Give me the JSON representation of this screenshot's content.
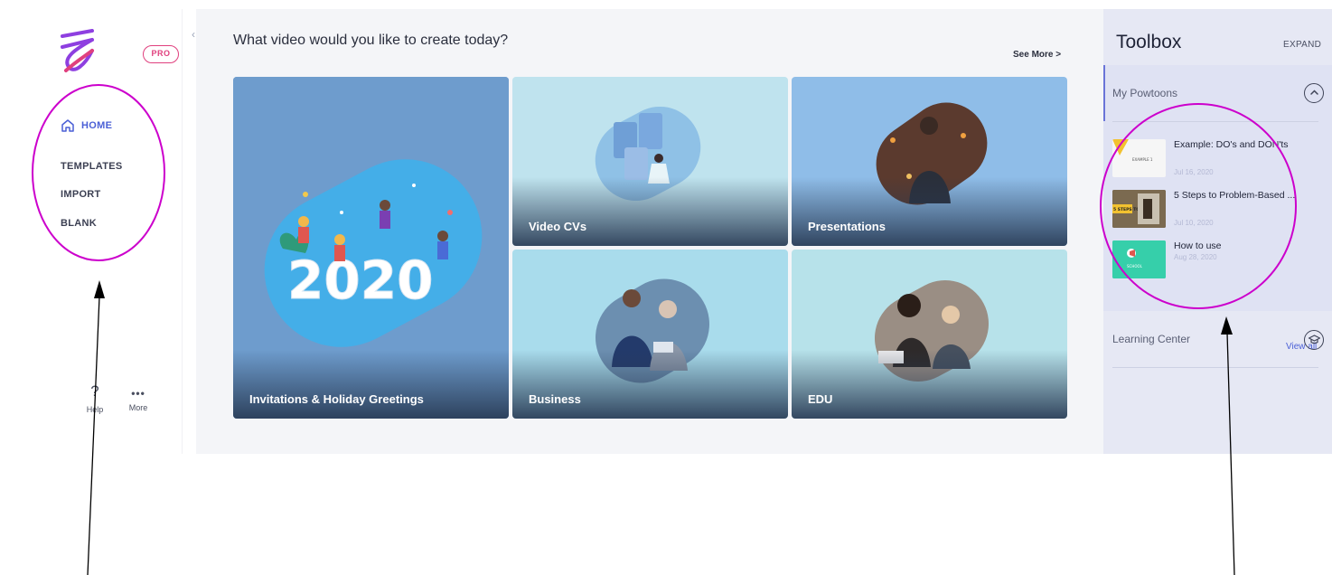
{
  "sidebar": {
    "badge": "PRO",
    "nav": {
      "home": "HOME",
      "templates": "TEMPLATES",
      "import": "IMPORT",
      "blank": "BLANK"
    },
    "help_label": "Help",
    "more_label": "More"
  },
  "main": {
    "heading": "What video would you like to create today?",
    "see_more": "See More >",
    "cards": [
      {
        "label": "Invitations & Holiday Greetings",
        "art_text": "2020"
      },
      {
        "label": "Video CVs"
      },
      {
        "label": "Presentations"
      },
      {
        "label": "Business"
      },
      {
        "label": "EDU"
      }
    ]
  },
  "toolbox": {
    "title": "Toolbox",
    "expand": "EXPAND",
    "my_powtoons": {
      "title": "My Powtoons",
      "items": [
        {
          "title": "Example: DO's and DON'ts",
          "date": "Jul 16, 2020",
          "thumb_text": "EXAMPLE 1"
        },
        {
          "title": "5 Steps to Problem-Based ...",
          "date": "Jul 10, 2020",
          "thumb_text": "5 STEPS TO"
        },
        {
          "title": "How to use",
          "date": "Aug 28, 2020",
          "thumb_text": "SCHOOL"
        }
      ],
      "view_all": "View all"
    },
    "learning_center": {
      "title": "Learning Center"
    }
  },
  "colors": {
    "accent": "#4a5fd6",
    "pro": "#e0407e",
    "annotation": "#cc00cc"
  }
}
